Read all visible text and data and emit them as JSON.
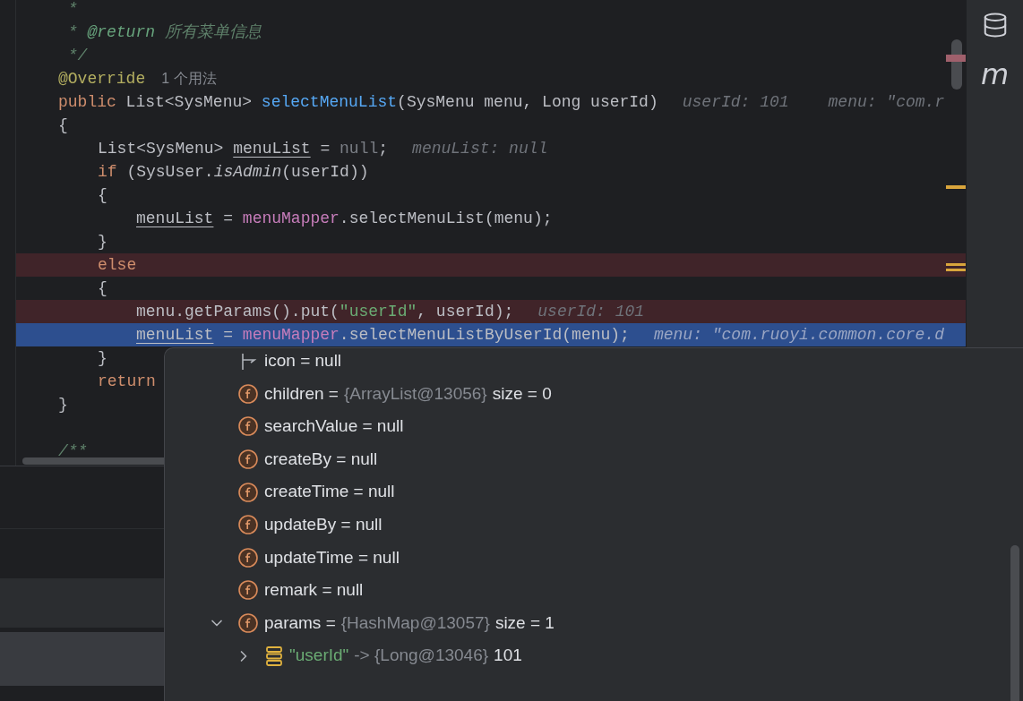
{
  "editor": {
    "lines": [
      {
        "breakpoint": false,
        "execution_point": false,
        "tokens": [
          {
            "kind": "comment",
            "text": " *"
          }
        ]
      },
      {
        "breakpoint": false,
        "execution_point": false,
        "tokens": [
          {
            "kind": "comment",
            "text": " * "
          },
          {
            "kind": "doc_tag",
            "text": "@return"
          },
          {
            "kind": "doc_text",
            "text": " 所有菜单信息"
          }
        ]
      },
      {
        "breakpoint": false,
        "execution_point": false,
        "tokens": [
          {
            "kind": "comment",
            "text": " */"
          }
        ]
      },
      {
        "breakpoint": false,
        "execution_point": false,
        "tokens": [
          {
            "kind": "annotation",
            "text": "@Override"
          },
          {
            "kind": "usage",
            "text": "1 个用法"
          }
        ]
      },
      {
        "breakpoint": false,
        "execution_point": false,
        "tokens": [
          {
            "kind": "keyword",
            "text": "public"
          },
          {
            "kind": "plain",
            "text": " List<SysMenu> "
          },
          {
            "kind": "method_decl",
            "text": "selectMenuList"
          },
          {
            "kind": "plain",
            "text": "(SysMenu menu, Long userId)"
          },
          {
            "kind": "hint",
            "text": "userId: 101"
          },
          {
            "kind": "hint",
            "text": "menu: \"com.r"
          }
        ]
      },
      {
        "breakpoint": false,
        "execution_point": false,
        "tokens": [
          {
            "kind": "plain",
            "text": "{"
          }
        ],
        "children": [
          {
            "breakpoint": false,
            "execution_point": false,
            "tokens": [
              {
                "kind": "plain",
                "text": "List<SysMenu> "
              },
              {
                "kind": "var",
                "text": "menuList"
              },
              {
                "kind": "plain",
                "text": " = "
              },
              {
                "kind": "null",
                "text": "null"
              },
              {
                "kind": "plain",
                "text": ";"
              },
              {
                "kind": "hint",
                "text": "menuList: null"
              }
            ]
          },
          {
            "breakpoint": false,
            "execution_point": false,
            "tokens": [
              {
                "kind": "keyword",
                "text": "if"
              },
              {
                "kind": "plain",
                "text": " (SysUser."
              },
              {
                "kind": "static_call",
                "text": "isAdmin"
              },
              {
                "kind": "plain",
                "text": "(userId))"
              }
            ]
          },
          {
            "breakpoint": false,
            "execution_point": false,
            "tokens": [
              {
                "kind": "plain",
                "text": "{"
              }
            ],
            "children": [
              {
                "breakpoint": false,
                "execution_point": false,
                "tokens": [
                  {
                    "kind": "var",
                    "text": "menuList"
                  },
                  {
                    "kind": "plain",
                    "text": " = "
                  },
                  {
                    "kind": "field",
                    "text": "menuMapper"
                  },
                  {
                    "kind": "plain",
                    "text": ".selectMenuList(menu);"
                  }
                ]
              }
            ]
          },
          {
            "breakpoint": false,
            "execution_point": false,
            "tokens": [
              {
                "kind": "plain",
                "text": "}"
              }
            ]
          },
          {
            "breakpoint": true,
            "execution_point": false,
            "tokens": [
              {
                "kind": "keyword",
                "text": "else"
              }
            ]
          },
          {
            "breakpoint": false,
            "execution_point": false,
            "tokens": [
              {
                "kind": "plain",
                "text": "{"
              }
            ],
            "children": [
              {
                "breakpoint": true,
                "execution_point": false,
                "tokens": [
                  {
                    "kind": "plain",
                    "text": "menu.getParams().put("
                  },
                  {
                    "kind": "string",
                    "text": "\"userId\""
                  },
                  {
                    "kind": "plain",
                    "text": ", userId);"
                  },
                  {
                    "kind": "hint",
                    "text": "userId: 101"
                  }
                ]
              },
              {
                "breakpoint": false,
                "execution_point": true,
                "tokens": [
                  {
                    "kind": "var",
                    "text": "menuList"
                  },
                  {
                    "kind": "plain",
                    "text": " = "
                  },
                  {
                    "kind": "field",
                    "text": "menuMapper"
                  },
                  {
                    "kind": "plain",
                    "text": ".selectMenuListByUserId(menu);"
                  },
                  {
                    "kind": "hint",
                    "text": "menu: \"com.ruoyi.common.core.d"
                  }
                ]
              }
            ]
          },
          {
            "breakpoint": false,
            "execution_point": false,
            "tokens": [
              {
                "kind": "plain",
                "text": "}"
              }
            ]
          },
          {
            "breakpoint": false,
            "execution_point": false,
            "tokens": [
              {
                "kind": "keyword",
                "text": "return"
              }
            ]
          }
        ]
      },
      {
        "breakpoint": false,
        "execution_point": false,
        "tokens": [
          {
            "kind": "plain",
            "text": "}"
          }
        ]
      },
      {
        "breakpoint": false,
        "execution_point": false
      },
      {
        "breakpoint": false,
        "execution_point": false,
        "tokens": [
          {
            "kind": "comment",
            "text": "/**"
          }
        ]
      }
    ]
  },
  "tool_strip": [
    {
      "kind": "database"
    },
    {
      "kind": "glyph",
      "text": "m"
    }
  ],
  "debug_popup": {
    "rows": [
      {
        "kind": "flag",
        "parts": [
          {
            "kind": "name",
            "text": "icon = null"
          }
        ]
      },
      {
        "kind": "field",
        "parts": [
          {
            "kind": "name",
            "text": "children ="
          },
          {
            "kind": "ref",
            "text": "{ArrayList@13056}"
          },
          {
            "kind": "value",
            "text": "size = 0"
          }
        ]
      },
      {
        "kind": "field",
        "parts": [
          {
            "kind": "name",
            "text": "searchValue = null"
          }
        ]
      },
      {
        "kind": "field",
        "parts": [
          {
            "kind": "name",
            "text": "createBy = null"
          }
        ]
      },
      {
        "kind": "field",
        "parts": [
          {
            "kind": "name",
            "text": "createTime = null"
          }
        ]
      },
      {
        "kind": "field",
        "parts": [
          {
            "kind": "name",
            "text": "updateBy = null"
          }
        ]
      },
      {
        "kind": "field",
        "parts": [
          {
            "kind": "name",
            "text": "updateTime = null"
          }
        ]
      },
      {
        "kind": "field",
        "parts": [
          {
            "kind": "name",
            "text": "remark = null"
          }
        ]
      },
      {
        "kind": "field",
        "expanded": true,
        "parts": [
          {
            "kind": "name",
            "text": "params ="
          },
          {
            "kind": "ref",
            "text": "{HashMap@13057}"
          },
          {
            "kind": "value",
            "text": "size = 1"
          }
        ],
        "children": [
          {
            "kind": "entry",
            "expanded": false,
            "parts": [
              {
                "kind": "string",
                "text": "\"userId\""
              },
              {
                "kind": "ref",
                "text": "-> {Long@13046}"
              },
              {
                "kind": "value",
                "text": "101"
              }
            ]
          }
        ]
      }
    ]
  }
}
